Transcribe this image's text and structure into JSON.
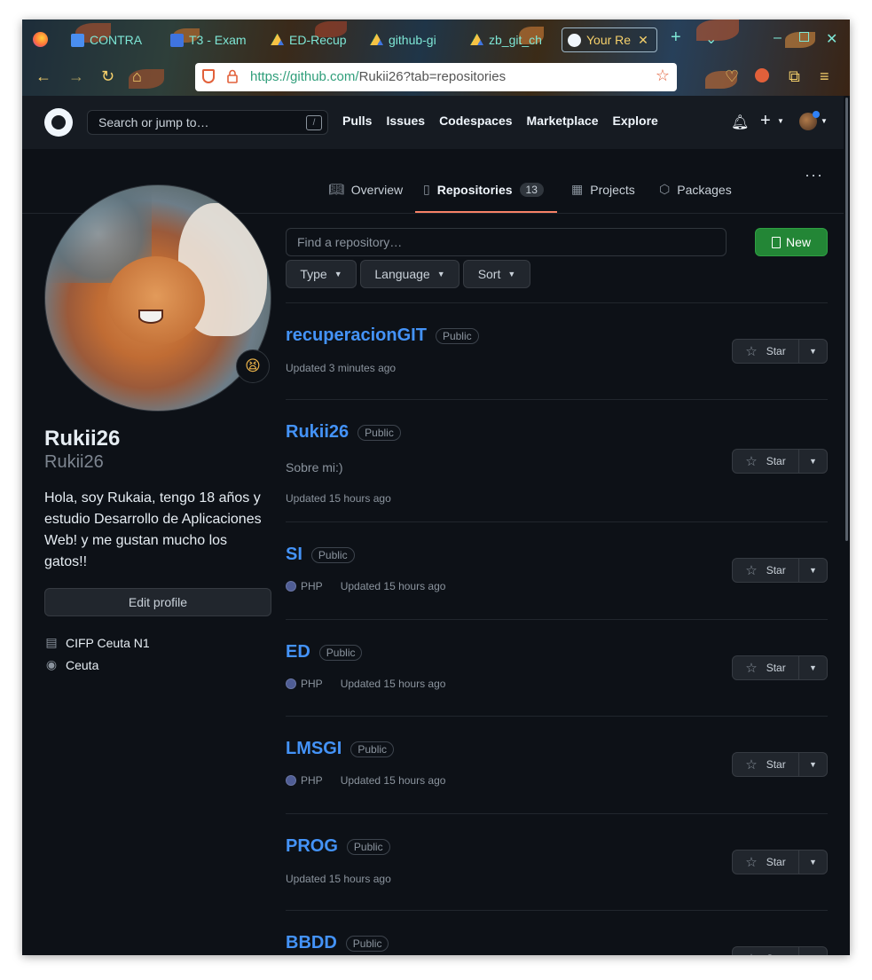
{
  "browser": {
    "tabs": [
      {
        "label": "CONTRA",
        "color": "#4a8ef0"
      },
      {
        "label": "T3 - Exam",
        "color": "#3f74e0"
      },
      {
        "label": "ED-Recup",
        "color": "#f6c244"
      },
      {
        "label": "github-gi",
        "color": "#f6c244"
      },
      {
        "label": "zb_git_ch",
        "color": "#f6c244"
      },
      {
        "label": "Your Re",
        "color": "#f0f6fc"
      }
    ],
    "url_host": "https://github.com/",
    "url_path": "Rukii26?tab=repositories"
  },
  "header": {
    "search_placeholder": "Search or jump to…",
    "search_shortcut": "/",
    "nav": [
      "Pulls",
      "Issues",
      "Codespaces",
      "Marketplace",
      "Explore"
    ]
  },
  "profile_tabs": {
    "overview": "Overview",
    "repositories": "Repositories",
    "repositories_count": "13",
    "projects": "Projects",
    "packages": "Packages"
  },
  "profile": {
    "fullname": "Rukii26",
    "username": "Rukii26",
    "bio": "Hola, soy Rukaia, tengo 18 años y estudio Desarrollo de Aplicaciones Web! y me gustan mucho los gatos!!",
    "edit_label": "Edit profile",
    "organization": "CIFP Ceuta N1",
    "location": "Ceuta",
    "status_emoji": "😫"
  },
  "repo_filters": {
    "search_placeholder": "Find a repository…",
    "new_label": "New",
    "type_label": "Type",
    "language_label": "Language",
    "sort_label": "Sort"
  },
  "star_label": "Star",
  "repos": [
    {
      "name": "recuperacionGIT",
      "visibility": "Public",
      "description": "",
      "language": "",
      "updated": "Updated 3 minutes ago"
    },
    {
      "name": "Rukii26",
      "visibility": "Public",
      "description": "Sobre mi:)",
      "language": "",
      "updated": "Updated 15 hours ago"
    },
    {
      "name": "SI",
      "visibility": "Public",
      "description": "",
      "language": "PHP",
      "updated": "Updated 15 hours ago"
    },
    {
      "name": "ED",
      "visibility": "Public",
      "description": "",
      "language": "PHP",
      "updated": "Updated 15 hours ago"
    },
    {
      "name": "LMSGI",
      "visibility": "Public",
      "description": "",
      "language": "PHP",
      "updated": "Updated 15 hours ago"
    },
    {
      "name": "PROG",
      "visibility": "Public",
      "description": "",
      "language": "",
      "updated": "Updated 15 hours ago"
    },
    {
      "name": "BBDD",
      "visibility": "Public",
      "description": "",
      "language": "",
      "updated": ""
    }
  ],
  "colors": {
    "php": "#4F5D95",
    "accent_tab": "#f78166",
    "link": "#4493f8",
    "new_button": "#238636"
  }
}
